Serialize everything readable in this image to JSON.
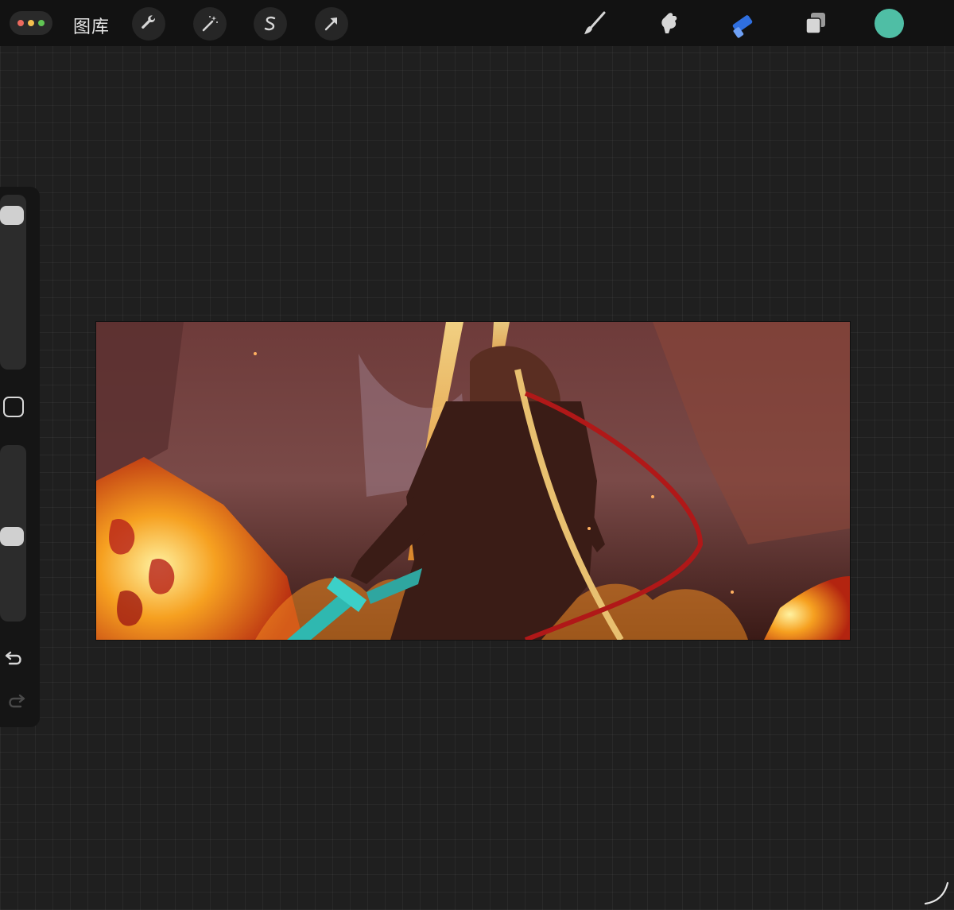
{
  "topbar": {
    "gallery_label": "图库",
    "left_tools": [
      {
        "name": "actions",
        "icon": "wrench-icon"
      },
      {
        "name": "adjustments",
        "icon": "magic-wand-icon"
      },
      {
        "name": "selection",
        "icon": "selection-s-icon"
      },
      {
        "name": "transform",
        "icon": "arrow-cursor-icon"
      }
    ],
    "right_tools": [
      {
        "name": "brush",
        "icon": "brush-icon"
      },
      {
        "name": "smudge",
        "icon": "smudge-icon"
      },
      {
        "name": "eraser",
        "icon": "eraser-icon",
        "active": true
      },
      {
        "name": "layers",
        "icon": "layers-icon"
      }
    ],
    "current_color": "#4fbea5",
    "active_tool_color": "#2f6fe0"
  },
  "sidebar": {
    "brush_size_level": 0.95,
    "opacity_level": 0.55,
    "modify_icon": "square-icon",
    "undo_icon": "undo-icon",
    "redo_icon": "redo-icon"
  },
  "canvas": {
    "artwork_description_icon": "artwork-image",
    "palette": {
      "background": "#5a3232",
      "fire": "#f0a020",
      "sword_glow": "#4fd0c8",
      "ribbon": "#b01818"
    }
  }
}
